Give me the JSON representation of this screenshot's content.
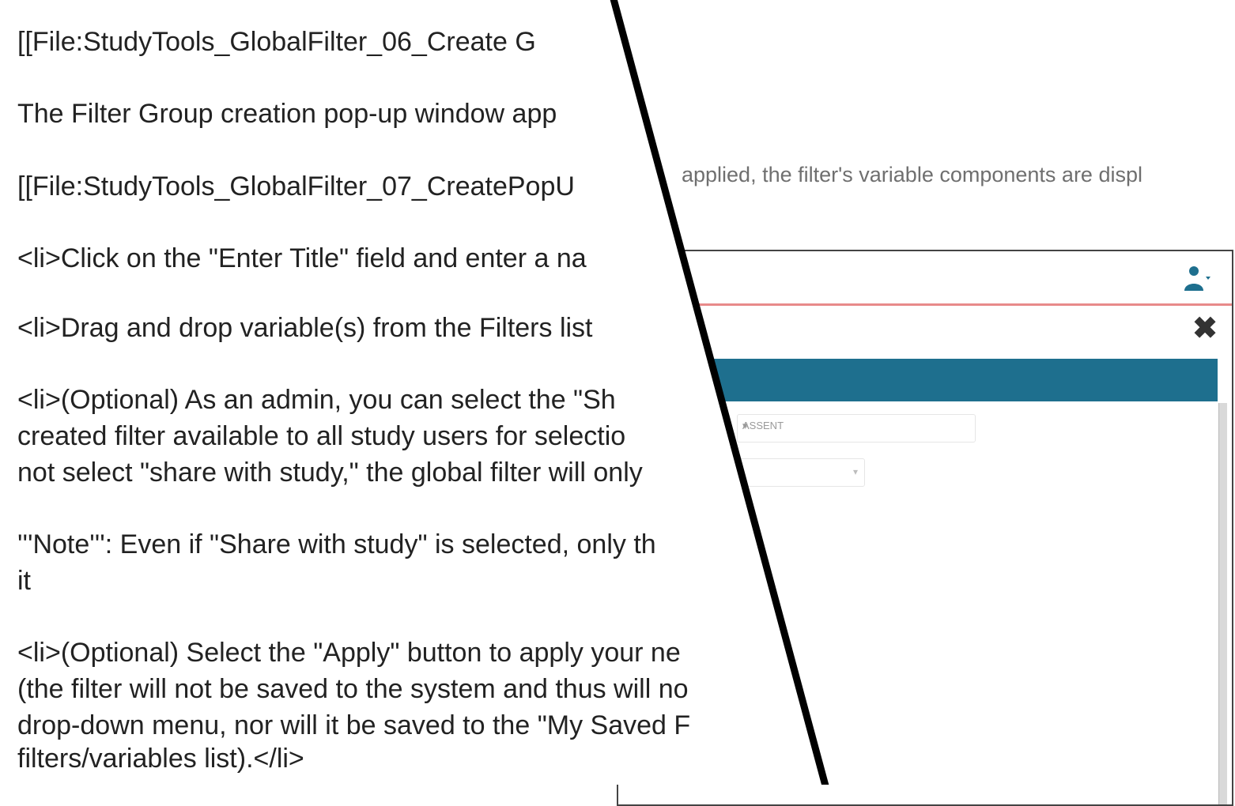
{
  "right_panel": {
    "caption": "applied, the filter's variable components are displ",
    "field_1_text": "ASSENT",
    "field_2_caret": "▾",
    "field_1_caret": "▾",
    "close_glyph": "✖"
  },
  "document": {
    "lines": [
      "[[File:StudyTools_GlobalFilter_06_Create G",
      "The Filter Group creation pop-up window app",
      "[[File:StudyTools_GlobalFilter_07_CreatePopU",
      "<li>Click on the \"Enter Title\" field and enter a na",
      "<li>Drag and drop variable(s) from the Filters list",
      "<li>(Optional) As an admin, you can select the \"Sh",
      "created filter available to all study users for selectio",
      "not select \"share with study,\" the global filter will only",
      "'''Note''': Even if \"Share with study\" is selected, only th",
      "it",
      "<li>(Optional) Select the \"Apply\" button to apply your ne",
      "(the filter will not be saved to the system and thus will no",
      "drop-down menu, nor will it be saved to the \"My Saved F",
      "filters/variables list).</li>"
    ]
  },
  "colors": {
    "header_accent": "#e88a8a",
    "teal_bar": "#1e6f8e",
    "icon_blue": "#1e6f8e"
  }
}
